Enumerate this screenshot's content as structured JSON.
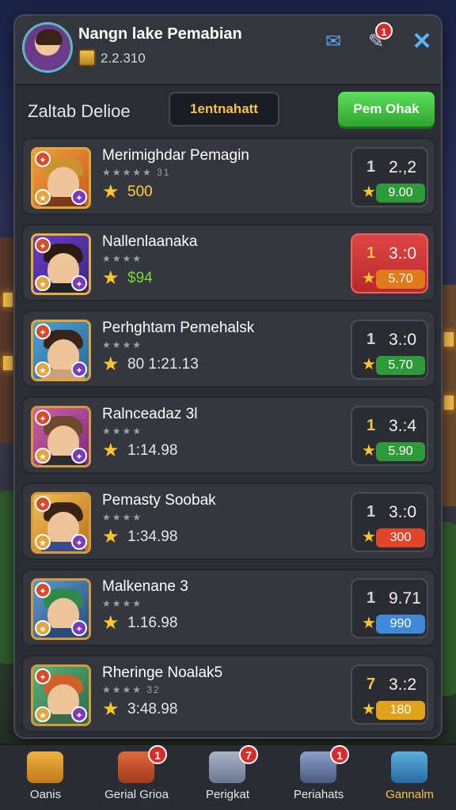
{
  "header": {
    "player_name": "Nangn lake Pemabian",
    "coins": "2.2.310",
    "mail_badge": "",
    "pen_badge": "1"
  },
  "subheader": {
    "title": "Zaltab Delioe",
    "filter_label": "1entnahatt",
    "action_label": "Pem Ohak"
  },
  "rows": [
    {
      "name": "Merimighdar Pemagin",
      "stars_text": "★★★★★ 31",
      "value": "500",
      "rank": "1",
      "score": "2.,2",
      "pill": "9.00",
      "pill_color": "#2f9a3a",
      "highlight": false
    },
    {
      "name": "Nallenlaanaka",
      "stars_text": "★★★★",
      "value": "$94",
      "rank": "1",
      "score": "3.:0",
      "pill": "5.70",
      "pill_color": "#e07a1a",
      "highlight": true
    },
    {
      "name": "Perhghtam Pemehalsk",
      "stars_text": "★★★★",
      "value": "80  1:21.13",
      "rank": "1",
      "score": "3.:0",
      "pill": "5.70",
      "pill_color": "#2f9a3a",
      "highlight": false
    },
    {
      "name": "Ralnceadaz 3l",
      "stars_text": "★★★★",
      "value": "1:14.98",
      "rank": "1",
      "score": "3.:4",
      "pill": "5.90",
      "pill_color": "#2f9a3a",
      "highlight": false
    },
    {
      "name": "Pemasty Soobak",
      "stars_text": "★★★★",
      "value": "1:34.98",
      "rank": "1",
      "score": "3.:0",
      "pill": "300",
      "pill_color": "#e0472a",
      "highlight": false
    },
    {
      "name": "Malkenane 3",
      "stars_text": "★★★★",
      "value": "1.16.98",
      "rank": "1",
      "score": "9.71",
      "pill": "990",
      "pill_color": "#3f8ad8",
      "highlight": false
    },
    {
      "name": "Rheringe Noalak5",
      "stars_text": "★★★★ 32",
      "value": "3:48.98",
      "rank": "7",
      "score": "3.:2",
      "pill": "180",
      "pill_color": "#e0a21a",
      "highlight": false
    }
  ],
  "nav": [
    {
      "label": "Oanis",
      "badge": ""
    },
    {
      "label": "Gerial Grioa",
      "badge": "1"
    },
    {
      "label": "Perigkat",
      "badge": "7"
    },
    {
      "label": "Periahats",
      "badge": "1"
    },
    {
      "label": "Gannalm",
      "badge": ""
    }
  ]
}
